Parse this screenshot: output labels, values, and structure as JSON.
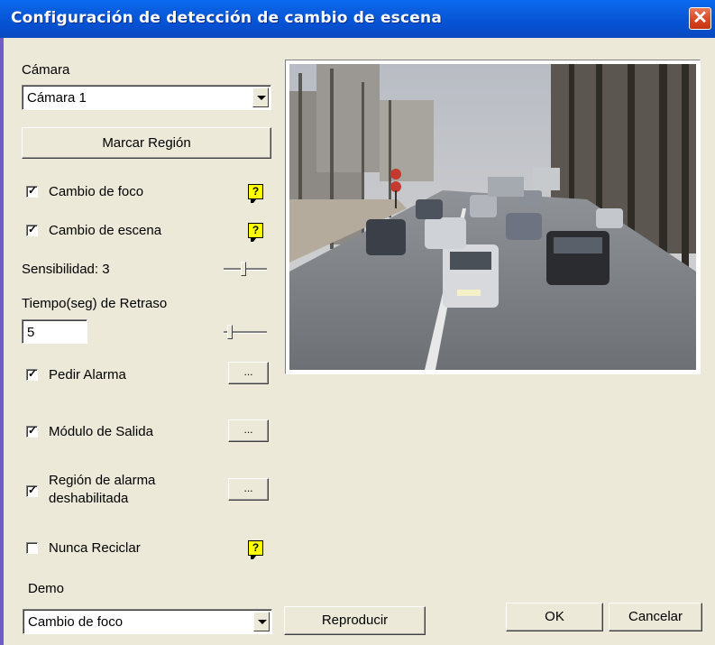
{
  "window": {
    "title": "Configuración de detección de cambio de escena",
    "close_symbol": "✕"
  },
  "camera": {
    "label": "Cámara",
    "selected": "Cámara 1"
  },
  "mark_region_button": "Marcar Región",
  "options": {
    "focus_change": {
      "label": "Cambio de foco",
      "checked": true
    },
    "scene_change": {
      "label": "Cambio de escena",
      "checked": true
    },
    "sensitivity": {
      "label": "Sensibilidad: 3",
      "value": 3
    },
    "delay": {
      "label": "Tiempo(seg) de Retraso",
      "value": "5"
    },
    "alarm_request": {
      "label": "Pedir Alarma",
      "checked": true
    },
    "output_module": {
      "label": "Módulo de Salida",
      "checked": true
    },
    "disabled_alarm_region": {
      "label_line1": "Región de alarma",
      "label_line2": "deshabilitada",
      "checked": true
    },
    "never_recycle": {
      "label": "Nunca Reciclar",
      "checked": false
    }
  },
  "ellipsis": "...",
  "help_symbol": "?",
  "check_symbol": "✓",
  "demo": {
    "label": "Demo",
    "selected": "Cambio de foco",
    "play_button": "Reproducir"
  },
  "buttons": {
    "ok": "OK",
    "cancel": "Cancelar"
  },
  "colors": {
    "titlebar": "#0a5fe0",
    "dialog_bg": "#ece9d8",
    "help_bg": "#ffff00",
    "close_bg": "#d9431f"
  },
  "icons": {
    "help": "help-icon",
    "close": "close-icon",
    "dropdown": "chevron-down-icon"
  }
}
